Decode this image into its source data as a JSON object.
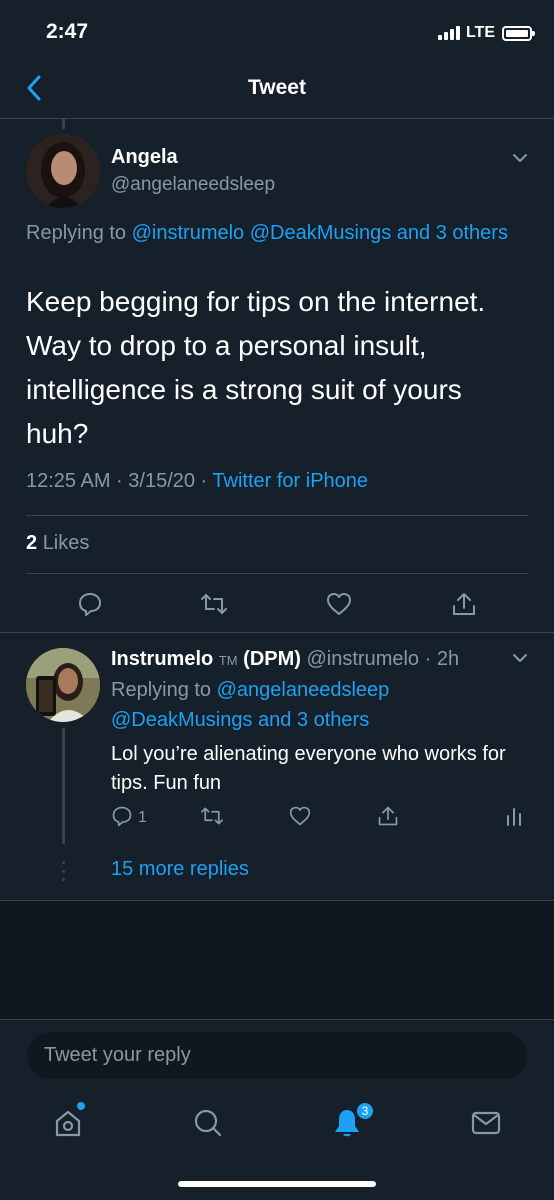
{
  "status_bar": {
    "time": "2:47",
    "network": "LTE"
  },
  "nav": {
    "title": "Tweet"
  },
  "main_tweet": {
    "author_name": "Angela",
    "author_handle": "@angelaneedsleep",
    "replying_prefix": "Replying to",
    "replying_links": "@instrumelo @DeakMusings and 3 others",
    "text": "Keep begging for tips on the internet. Way to drop to a personal insult, intelligence is a strong suit of yours huh?",
    "timestamp": "12:25 AM · 3/15/20 · ",
    "source": "Twitter for iPhone",
    "likes_count": "2",
    "likes_label": "Likes"
  },
  "reply_tweet": {
    "author_name": "Instrumelo",
    "author_tm": "TM",
    "author_suffix": "(DPM)",
    "author_handle": "@instrumelo",
    "time_ago": "· 2h",
    "replying_prefix": "Replying to",
    "replying_links_1": "@angelaneedsleep",
    "replying_links_2": "@DeakMusings and 3 others",
    "text": "Lol you’re alienating everyone who works for tips. Fun fun",
    "reply_count": "1",
    "more_replies": "15 more replies"
  },
  "compose": {
    "placeholder": "Tweet your reply"
  },
  "tab_bar": {
    "notifications_badge": "3"
  },
  "colors": {
    "background": "#15202b",
    "accent": "#1da1f2",
    "secondary_text": "#8899a6",
    "divider": "#38444d"
  }
}
